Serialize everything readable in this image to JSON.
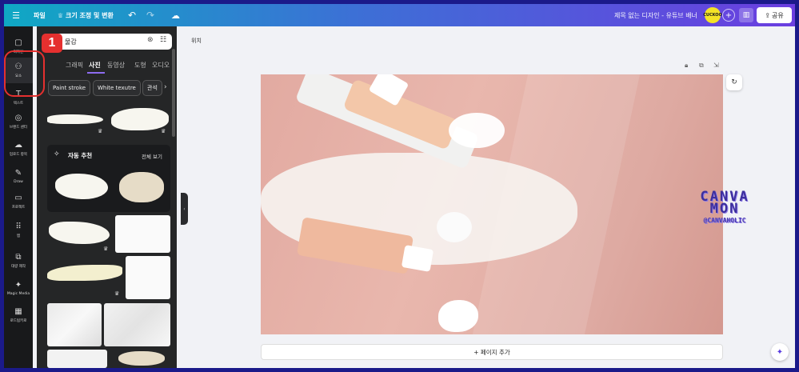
{
  "topbar": {
    "file": "파일",
    "resize": "♕ 크기 조정 및 변환",
    "title": "제목 없는 디자인 - 유튜브 배너",
    "avatar": "CUCKOO",
    "share": "공유"
  },
  "rail": {
    "items": [
      {
        "label": "디자인",
        "icon": "▢"
      },
      {
        "label": "요소",
        "icon": "⚇"
      },
      {
        "label": "텍스트",
        "icon": "T"
      },
      {
        "label": "브랜드 센터",
        "icon": "◎"
      },
      {
        "label": "업로드 항목",
        "icon": "☁"
      },
      {
        "label": "Draw",
        "icon": "✎"
      },
      {
        "label": "프로젝트",
        "icon": "▭"
      },
      {
        "label": "앱",
        "icon": "⠿"
      },
      {
        "label": "대량 제작",
        "icon": "⧉"
      },
      {
        "label": "Magic Media",
        "icon": "✦"
      },
      {
        "label": "로드됨키로",
        "icon": "▦"
      }
    ]
  },
  "annotation": {
    "badge": "1"
  },
  "panel": {
    "search_value": "물감",
    "tabs": [
      "그래픽",
      "사진",
      "동영상",
      "도형",
      "오디오"
    ],
    "active_tab": "사진",
    "chips": [
      "Paint stroke",
      "White texutre",
      "관석"
    ],
    "auto_title": "자동 추천",
    "auto_all": "전체 보기"
  },
  "canvas": {
    "position_label": "위치",
    "add_page": "+ 페이지 추가"
  },
  "watermark": {
    "line1": "CANVA",
    "line2": "MON",
    "line3": "@CANVAHOLIC"
  },
  "colors": {
    "accent": "#8d6cf0",
    "annotation": "#e5302f",
    "topbar_start": "#0fa8c4",
    "topbar_end": "#6b3ee0"
  }
}
